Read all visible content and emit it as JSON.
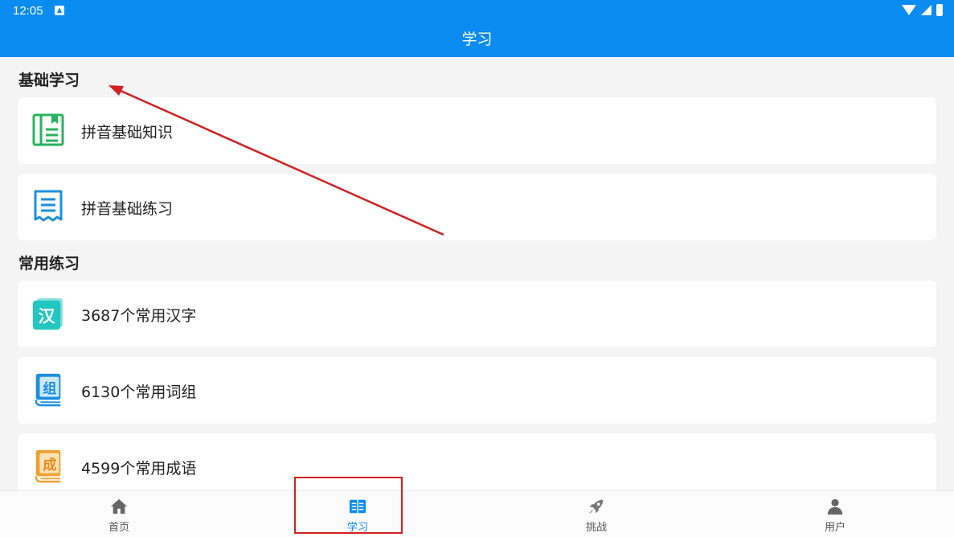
{
  "status_bar": {
    "time": "12:05"
  },
  "app_bar": {
    "title": "学习"
  },
  "sections": [
    {
      "title": "基础学习",
      "items": [
        {
          "label": "拼音基础知识",
          "icon": "book-green-icon"
        },
        {
          "label": "拼音基础练习",
          "icon": "receipt-blue-icon"
        }
      ]
    },
    {
      "title": "常用练习",
      "items": [
        {
          "label": "3687个常用汉字",
          "icon": "han-character-icon"
        },
        {
          "label": "6130个常用词组",
          "icon": "zu-book-icon"
        },
        {
          "label": "4599个常用成语",
          "icon": "cheng-book-icon"
        }
      ]
    }
  ],
  "icon_glyphs": {
    "han": "汉",
    "zu": "组",
    "cheng": "成"
  },
  "tabbar": {
    "tabs": [
      {
        "label": "首页",
        "icon": "home-icon",
        "active": false
      },
      {
        "label": "学习",
        "icon": "open-book-icon",
        "active": true
      },
      {
        "label": "挑战",
        "icon": "rocket-icon",
        "active": false
      },
      {
        "label": "用户",
        "icon": "user-icon",
        "active": false
      }
    ]
  },
  "colors": {
    "primary": "#0a8cf0",
    "annotation": "#d32020",
    "green": "#27b35f",
    "blue": "#1b8fe0",
    "teal": "#22c7c0",
    "orange": "#f0a030"
  }
}
